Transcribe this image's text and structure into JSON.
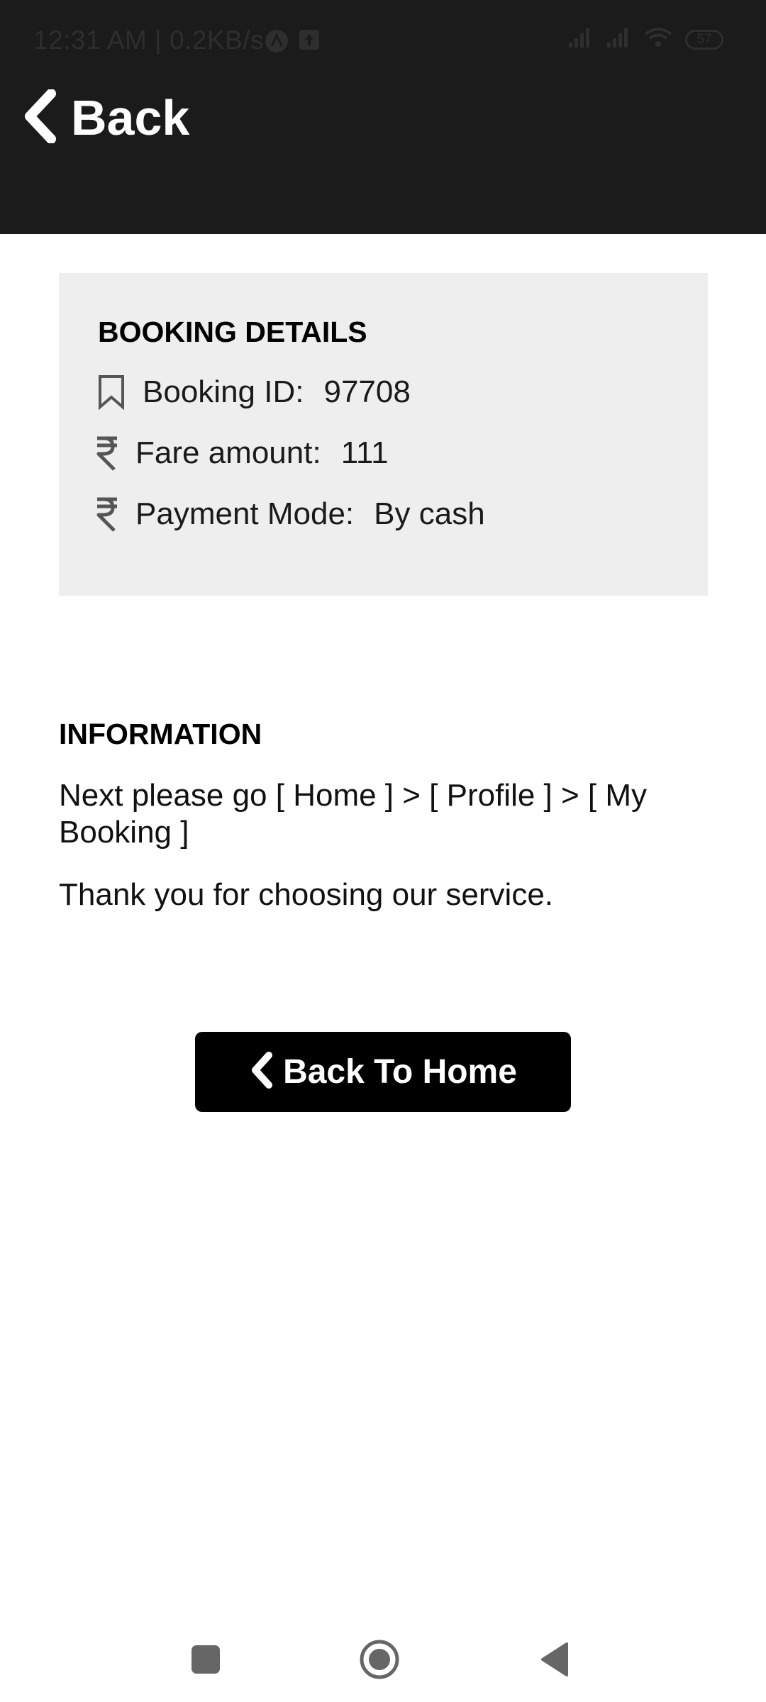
{
  "status_bar": {
    "time_speed": "12:31 AM | 0.2KB/s",
    "battery": "57"
  },
  "header": {
    "back_label": "Back"
  },
  "booking": {
    "title": "BOOKING DETAILS",
    "rows": [
      {
        "icon": "bookmark-icon",
        "label": "Booking ID:",
        "value": "97708"
      },
      {
        "icon": "rupee-icon",
        "label": "Fare amount:",
        "value": "111"
      },
      {
        "icon": "rupee-icon",
        "label": "Payment Mode:",
        "value": "By cash"
      }
    ]
  },
  "information": {
    "title": "INFORMATION",
    "line1": "Next please go [ Home ] > [ Profile ] > [ My Booking ]",
    "line2": "Thank you for choosing our service."
  },
  "home_button": {
    "label": "Back To Home"
  },
  "colors": {
    "header_bg": "#1b1b1b",
    "card_bg": "#eeeeee",
    "button_bg": "#000000",
    "text": "#000000"
  },
  "navigation_bar": {
    "icons": [
      "recents-square-icon",
      "home-circle-icon",
      "back-triangle-icon"
    ]
  }
}
